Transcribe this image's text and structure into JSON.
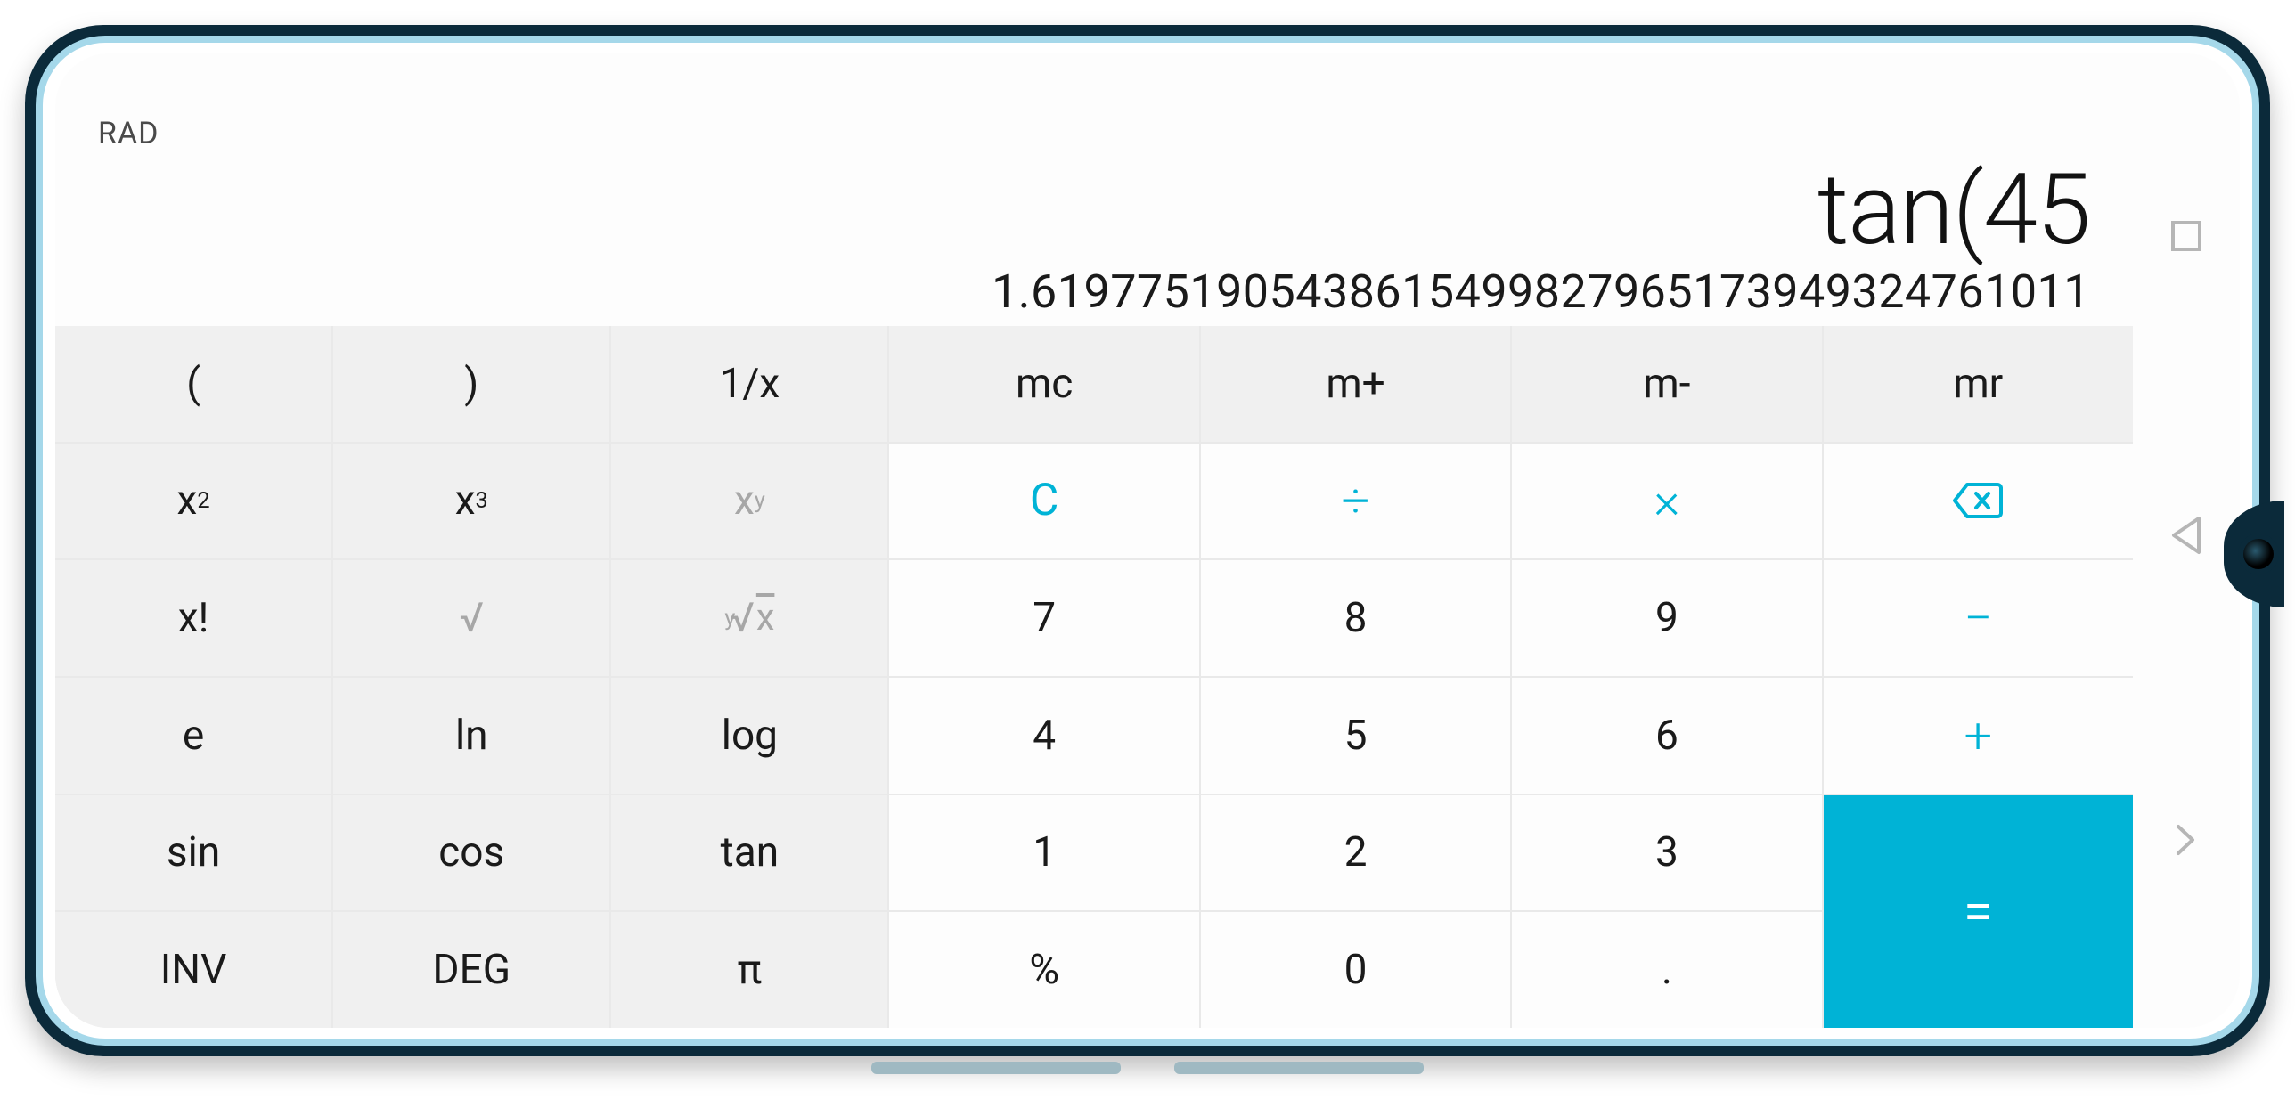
{
  "display": {
    "angle_mode": "RAD",
    "expression": "tan(45",
    "result": "1.6197751905438615499827965173949324761011"
  },
  "keys": {
    "lparen": "(",
    "rparen": ")",
    "reciprocal": "1/x",
    "mc": "mc",
    "mplus": "m+",
    "mminus": "m-",
    "mr": "mr",
    "x2_base": "x",
    "x2_exp": "2",
    "x3_base": "x",
    "x3_exp": "3",
    "xy_base": "x",
    "xy_exp": "y",
    "clear": "C",
    "divide": "÷",
    "multiply": "×",
    "factorial": "x!",
    "sqrt": "√",
    "yroot_idx": "y",
    "yroot_rad": "x",
    "n7": "7",
    "n8": "8",
    "n9": "9",
    "minus": "−",
    "e": "e",
    "ln": "ln",
    "log": "log",
    "n4": "4",
    "n5": "5",
    "n6": "6",
    "plus": "+",
    "sin": "sin",
    "cos": "cos",
    "tan": "tan",
    "n1": "1",
    "n2": "2",
    "n3": "3",
    "equals": "=",
    "inv": "INV",
    "deg": "DEG",
    "pi": "π",
    "percent": "%",
    "n0": "0",
    "dot": "."
  }
}
